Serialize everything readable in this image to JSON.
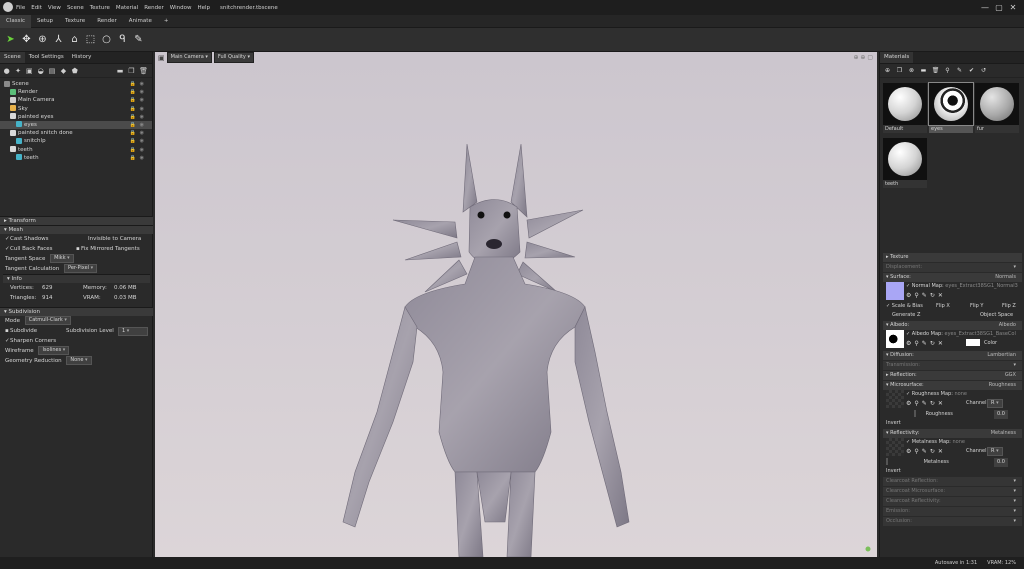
{
  "window": {
    "menu": [
      "File",
      "Edit",
      "View",
      "Scene",
      "Texture",
      "Material",
      "Render",
      "Window",
      "Help"
    ],
    "filename": "snitchrender.tbscene",
    "controls": [
      "—",
      "▢",
      "✕"
    ]
  },
  "mode_tabs": [
    "Classic",
    "Setup",
    "Texture",
    "Render",
    "Animate",
    "+"
  ],
  "scene_panel": {
    "tabs": [
      "Scene",
      "Tool Settings",
      "History"
    ],
    "tree": [
      {
        "label": "Scene",
        "indent": 0,
        "color": "#8a8a8a"
      },
      {
        "label": "Render",
        "indent": 1,
        "color": "#5bbf7a"
      },
      {
        "label": "Main Camera",
        "indent": 1,
        "color": "#cfcfcf"
      },
      {
        "label": "Sky",
        "indent": 1,
        "color": "#e8b24a"
      },
      {
        "label": "painted eyes",
        "indent": 1,
        "color": "#d9d9d9"
      },
      {
        "label": "eyes",
        "indent": 2,
        "color": "#46b3c8"
      },
      {
        "label": "painted snitch done",
        "indent": 1,
        "color": "#d9d9d9"
      },
      {
        "label": "snitchlp",
        "indent": 2,
        "color": "#46b3c8"
      },
      {
        "label": "teeth",
        "indent": 1,
        "color": "#d9d9d9"
      },
      {
        "label": "teeth",
        "indent": 2,
        "color": "#46b3c8"
      }
    ],
    "selected_index": 5
  },
  "properties": {
    "transform": "Transform",
    "mesh": "Mesh",
    "cast_shadows": "Cast Shadows",
    "invisible_to_camera": "Invisible to Camera",
    "cull_back_faces": "Cull Back Faces",
    "fix_mirrored_tangents": "Fix Mirrored Tangents",
    "tangent_space_label": "Tangent Space",
    "tangent_space_value": "Mikk",
    "tangent_calc_label": "Tangent Calculation",
    "tangent_calc_value": "Per-Pixel",
    "info": "Info",
    "vertices_label": "Vertices:",
    "vertices_value": "629",
    "memory_label": "Memory:",
    "memory_value": "0.06 MB",
    "triangles_label": "Triangles:",
    "triangles_value": "914",
    "vram_label": "VRAM:",
    "vram_value": "0.03 MB",
    "subdivision": "Subdivision",
    "mode_label": "Mode",
    "mode_value": "Catmull-Clark",
    "subdivide": "Subdivide",
    "subdivision_level_label": "Subdivision Level",
    "subdivision_level_value": "1",
    "sharpen_corners": "Sharpen Corners",
    "wireframe_label": "Wireframe",
    "wireframe_value": "Isolines",
    "geometry_reduction_label": "Geometry Reduction",
    "geometry_reduction_value": "None"
  },
  "viewport": {
    "camera": "Main Camera",
    "quality": "Full Quality"
  },
  "materials": {
    "tab": "Materials",
    "items": [
      {
        "name": "Default",
        "style": "white"
      },
      {
        "name": "eyes",
        "style": "eyes"
      },
      {
        "name": "fur",
        "style": "fur"
      },
      {
        "name": "teeth",
        "style": "white"
      }
    ],
    "sections": {
      "texture": "Texture",
      "displacement": "Displacement:",
      "surface": "Surface:",
      "surface_value": "Normals",
      "normal_map_label": "Normal Map:",
      "normal_map_value": "eyes_Extract38SG1_Normal3",
      "scale_bias": "Scale & Bias",
      "flip_x": "Flip X",
      "flip_y": "Flip Y",
      "flip_z": "Flip Z",
      "generate_z": "Generate Z",
      "object_space": "Object Space",
      "albedo": "Albedo:",
      "albedo_value": "Albedo",
      "albedo_map_label": "Albedo Map:",
      "albedo_map_value": "eyes_Extract38SG1_BaseCol",
      "color": "Color",
      "diffusion": "Diffusion:",
      "diffusion_value": "Lambertian",
      "transmission": "Transmission:",
      "reflection": "Reflection:",
      "reflection_value": "GGX",
      "microsurface": "Microsurface:",
      "microsurface_value": "Roughness",
      "roughness_map_label": "Roughness Map:",
      "roughness_map_value": "none",
      "channel": "Channel",
      "channel_value": "R",
      "roughness": "Roughness",
      "roughness_value": "0.0",
      "invert": "Invert",
      "reflectivity": "Reflectivity:",
      "reflectivity_value": "Metalness",
      "metalness_map_label": "Metalness Map:",
      "metalness_map_value": "none",
      "metalness": "Metalness",
      "metalness_value": "0.0",
      "clearcoat_reflection": "Clearcoat Reflection:",
      "clearcoat_microsurface": "Clearcoat Microsurface:",
      "clearcoat_reflectivity": "Clearcoat Reflectivity:",
      "emission": "Emission:",
      "occlusion": "Occlusion:"
    }
  },
  "status": {
    "autosave": "Autosave in 1:31",
    "vram": "VRAM: 12%"
  }
}
